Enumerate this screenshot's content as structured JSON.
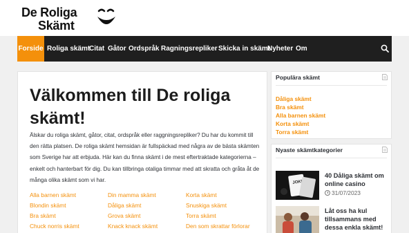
{
  "site": {
    "logo_line1": "De Roliga",
    "logo_line2": "Skämt"
  },
  "nav": {
    "items": [
      "Forside",
      "Roliga skämt",
      "Citat",
      "Gåtor",
      "Ordspråk",
      "Ragningsrepliker",
      "Skicka in skämt",
      "Nyheter",
      "Om"
    ],
    "active_color": "#f4900b",
    "bg_color": "#1f1f1f",
    "search_icon": "search-icon"
  },
  "main": {
    "title": "Välkommen till De roliga skämt!",
    "intro": "Älskar du roliga skämt, gåtor, citat, ordspråk eller raggningsrepliker? Du har du kommit till den rätta platsen. De roliga skämt hemsidan är fullspäckad med några av de bästa skämten som Sverige har att erbjuda. Här kan du finna skämt i de mest eftertraktade kategorierna – enkelt och hanterbart för dig. Du kan tillbringa otaliga timmar med att skratta och gråta åt de många olika skämt som vi har.",
    "category_links": [
      [
        "Alla barnen skämt",
        "Din mamma skämt",
        "Korta skämt"
      ],
      [
        "Blondin skämt",
        "Dåliga skämt",
        "Snuskiga skämt"
      ],
      [
        "Bra skämt",
        "Grova skämt",
        "Torra skämt"
      ],
      [
        "Chuck norris skämt",
        "Knack knack skämt",
        "Den som skrattar förlorar"
      ]
    ]
  },
  "sidebar": {
    "popular": {
      "title": "Populära skämt",
      "links": [
        "Dåliga skämt",
        "Bra skämt",
        "Alla barnen skämt",
        "Korta skämt",
        "Torra skämt"
      ]
    },
    "newest": {
      "title": "Nyaste skämtkategorier",
      "posts": [
        {
          "title": "40 Dåliga skämt om online casino",
          "date": "31/07/2023"
        },
        {
          "title": "Låt oss ha kul tillsammans med dessa enkla skämt!",
          "date": ""
        }
      ]
    }
  },
  "colors": {
    "accent": "#f4900b",
    "nav_bg": "#1f1f1f",
    "page_bg": "#f0f0f0"
  }
}
